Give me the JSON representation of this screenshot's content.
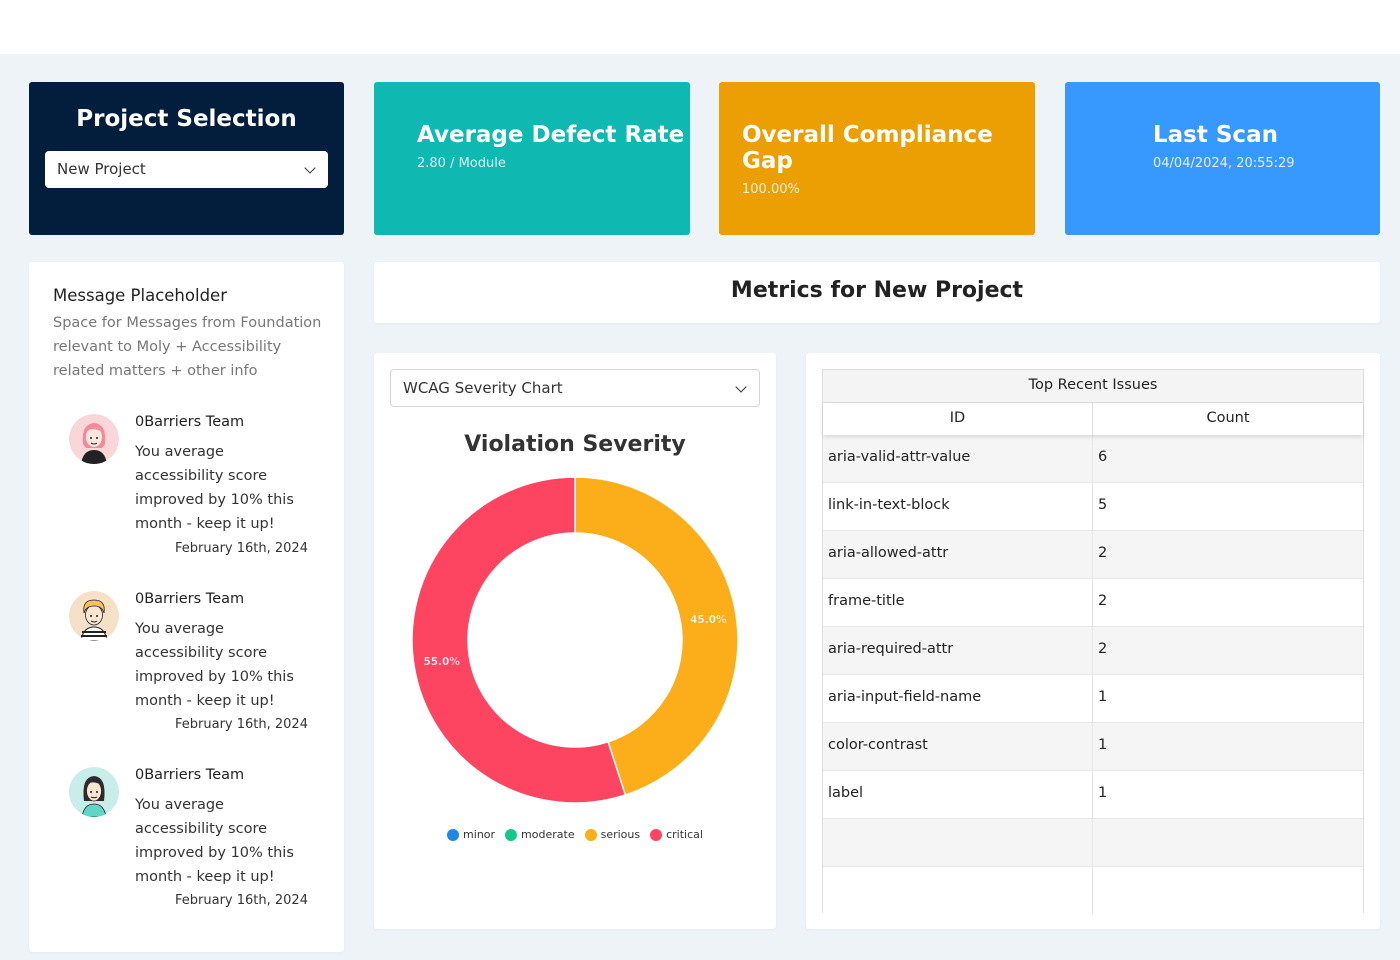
{
  "project_card": {
    "title": "Project Selection",
    "selected": "New Project"
  },
  "stats": {
    "defect": {
      "title": "Average Defect Rate",
      "value": "2.80 / Module",
      "color": "#0fb8b0"
    },
    "gap": {
      "title": "Overall Compliance Gap",
      "value": "100.00%",
      "color": "#ec9f03"
    },
    "scan": {
      "title": "Last Scan",
      "value": "04/04/2024, 20:55:29",
      "color": "#3798fe"
    }
  },
  "messages": {
    "heading": "Message Placeholder",
    "description": "Space for Messages from Foundation relevant to Moly + Accessibility related matters + other info",
    "items": [
      {
        "author": "0Barriers Team",
        "text": "You average accessibility score improved by 10% this month - keep it up!",
        "date": "February 16th, 2024",
        "avatar_icon": "avatar-woman-pink-hair-icon"
      },
      {
        "author": "0Barriers Team",
        "text": "You average accessibility score improved by 10% this month - keep it up!",
        "date": "February 16th, 2024",
        "avatar_icon": "avatar-man-curly-hair-icon"
      },
      {
        "author": "0Barriers Team",
        "text": "You average accessibility score improved by 10% this month - keep it up!",
        "date": "February 16th, 2024",
        "avatar_icon": "avatar-woman-dark-hair-icon"
      }
    ]
  },
  "metrics_title": "Metrics for New Project",
  "chart_selector": {
    "selected": "WCAG Severity Chart"
  },
  "chart_data": {
    "type": "pie",
    "title": "Violation Severity",
    "categories": [
      "minor",
      "moderate",
      "serious",
      "critical"
    ],
    "values": [
      0,
      0,
      45.0,
      55.0
    ],
    "data_labels": [
      "",
      "",
      "45.0%",
      "55.0%"
    ],
    "colors": [
      "#1e88e5",
      "#13c98a",
      "#fbad1a",
      "#fd4562"
    ],
    "legend_position": "bottom"
  },
  "issues_table": {
    "caption": "Top Recent Issues",
    "columns": [
      "ID",
      "Count"
    ],
    "rows": [
      [
        "aria-valid-attr-value",
        "6"
      ],
      [
        "link-in-text-block",
        "5"
      ],
      [
        "aria-allowed-attr",
        "2"
      ],
      [
        "frame-title",
        "2"
      ],
      [
        "aria-required-attr",
        "2"
      ],
      [
        "aria-input-field-name",
        "1"
      ],
      [
        "color-contrast",
        "1"
      ],
      [
        "label",
        "1"
      ],
      [
        "",
        ""
      ],
      [
        "",
        ""
      ]
    ]
  }
}
